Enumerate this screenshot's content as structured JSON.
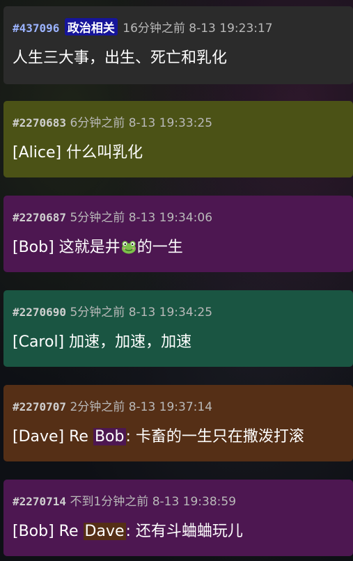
{
  "posts": [
    {
      "id": "#437096",
      "tag": "政治相关",
      "time": "16分钟之前 8-13 19:23:17",
      "text": "人生三大事，出生、死亡和乳化",
      "bg": "#2b2b2b"
    },
    {
      "id": "#2270683",
      "time": "6分钟之前 8-13 19:33:25",
      "text": "[Alice] 什么叫乳化",
      "bg": "#4b5216"
    },
    {
      "id": "#2270687",
      "time": "5分钟之前 8-13 19:34:06",
      "text_before": "[Bob] 这就是井",
      "emoji": "frog-icon",
      "text_after": "的一生",
      "bg": "#4d1751"
    },
    {
      "id": "#2270690",
      "time": "5分钟之前 8-13 19:34:25",
      "text": "[Carol] 加速，加速，加速",
      "bg": "#1a5542"
    },
    {
      "id": "#2270707",
      "time": "2分钟之前 8-13 19:37:14",
      "text_before": "[Dave] Re ",
      "mention": "Bob",
      "mention_bg": "#4d1751",
      "text_after": ": 卡畜的一生只在撒泼打滚",
      "bg": "#552f16"
    },
    {
      "id": "#2270714",
      "time": "不到1分钟之前 8-13 19:38:59",
      "text_before": "[Bob] Re ",
      "mention": "Dave",
      "mention_bg": "#552f16",
      "text_after": ": 还有斗蛐蛐玩儿",
      "bg": "#4d1751"
    }
  ]
}
